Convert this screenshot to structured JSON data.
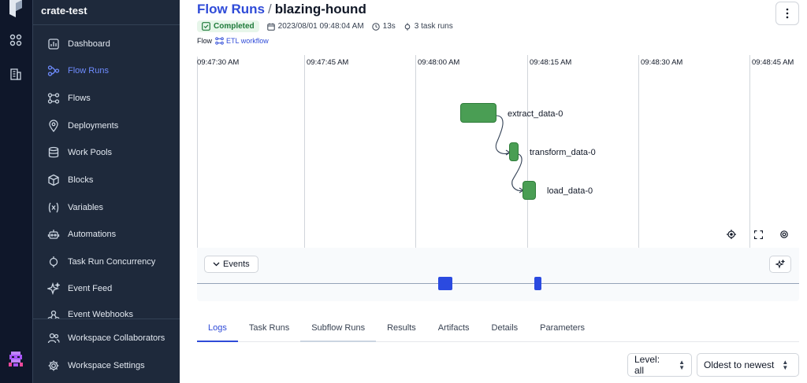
{
  "workspace": {
    "name": "crate-test",
    "hint": ""
  },
  "sidebar": {
    "items": [
      {
        "label": "Dashboard",
        "icon": "dashboard-icon",
        "active": false
      },
      {
        "label": "Flow Runs",
        "icon": "flow-runs-icon",
        "active": true
      },
      {
        "label": "Flows",
        "icon": "flows-icon",
        "active": false
      },
      {
        "label": "Deployments",
        "icon": "location-pin-icon",
        "active": false
      },
      {
        "label": "Work Pools",
        "icon": "database-icon",
        "active": false
      },
      {
        "label": "Blocks",
        "icon": "cube-icon",
        "active": false
      },
      {
        "label": "Variables",
        "icon": "variable-icon",
        "active": false
      },
      {
        "label": "Automations",
        "icon": "robot-icon",
        "active": false
      },
      {
        "label": "Task Run Concurrency",
        "icon": "concurrency-icon",
        "active": false
      },
      {
        "label": "Event Feed",
        "icon": "sparkles-icon",
        "active": false
      },
      {
        "label": "Event Webhooks",
        "icon": "webhook-icon",
        "active": false
      }
    ],
    "footer": [
      {
        "label": "Workspace Collaborators",
        "icon": "users-icon"
      },
      {
        "label": "Workspace Settings",
        "icon": "gear-icon"
      }
    ]
  },
  "header": {
    "breadcrumb_link": "Flow Runs",
    "separator": "/",
    "run_name": "blazing-hound",
    "state": "Completed",
    "start_time": "2023/08/01 09:48:04 AM",
    "duration": "13s",
    "task_runs": "3 task runs",
    "flow_label": "Flow",
    "flow_name": "ETL workflow"
  },
  "timeline": {
    "ticks": [
      "09:47:30 AM",
      "09:47:45 AM",
      "09:48:00 AM",
      "09:48:15 AM",
      "09:48:30 AM",
      "09:48:45 AM"
    ],
    "nodes": [
      "extract_data-0",
      "transform_data-0",
      "load_data-0"
    ],
    "events_label": "Events"
  },
  "tabs": [
    "Logs",
    "Task Runs",
    "Subflow Runs",
    "Results",
    "Artifacts",
    "Details",
    "Parameters"
  ],
  "filters": {
    "level": "Level: all",
    "sort": "Oldest to newest"
  },
  "colors": {
    "accent": "#2f4bd8",
    "completed": "#4a9e54",
    "event_marker": "#2b4ae0",
    "sidebar": "#1e293b"
  }
}
